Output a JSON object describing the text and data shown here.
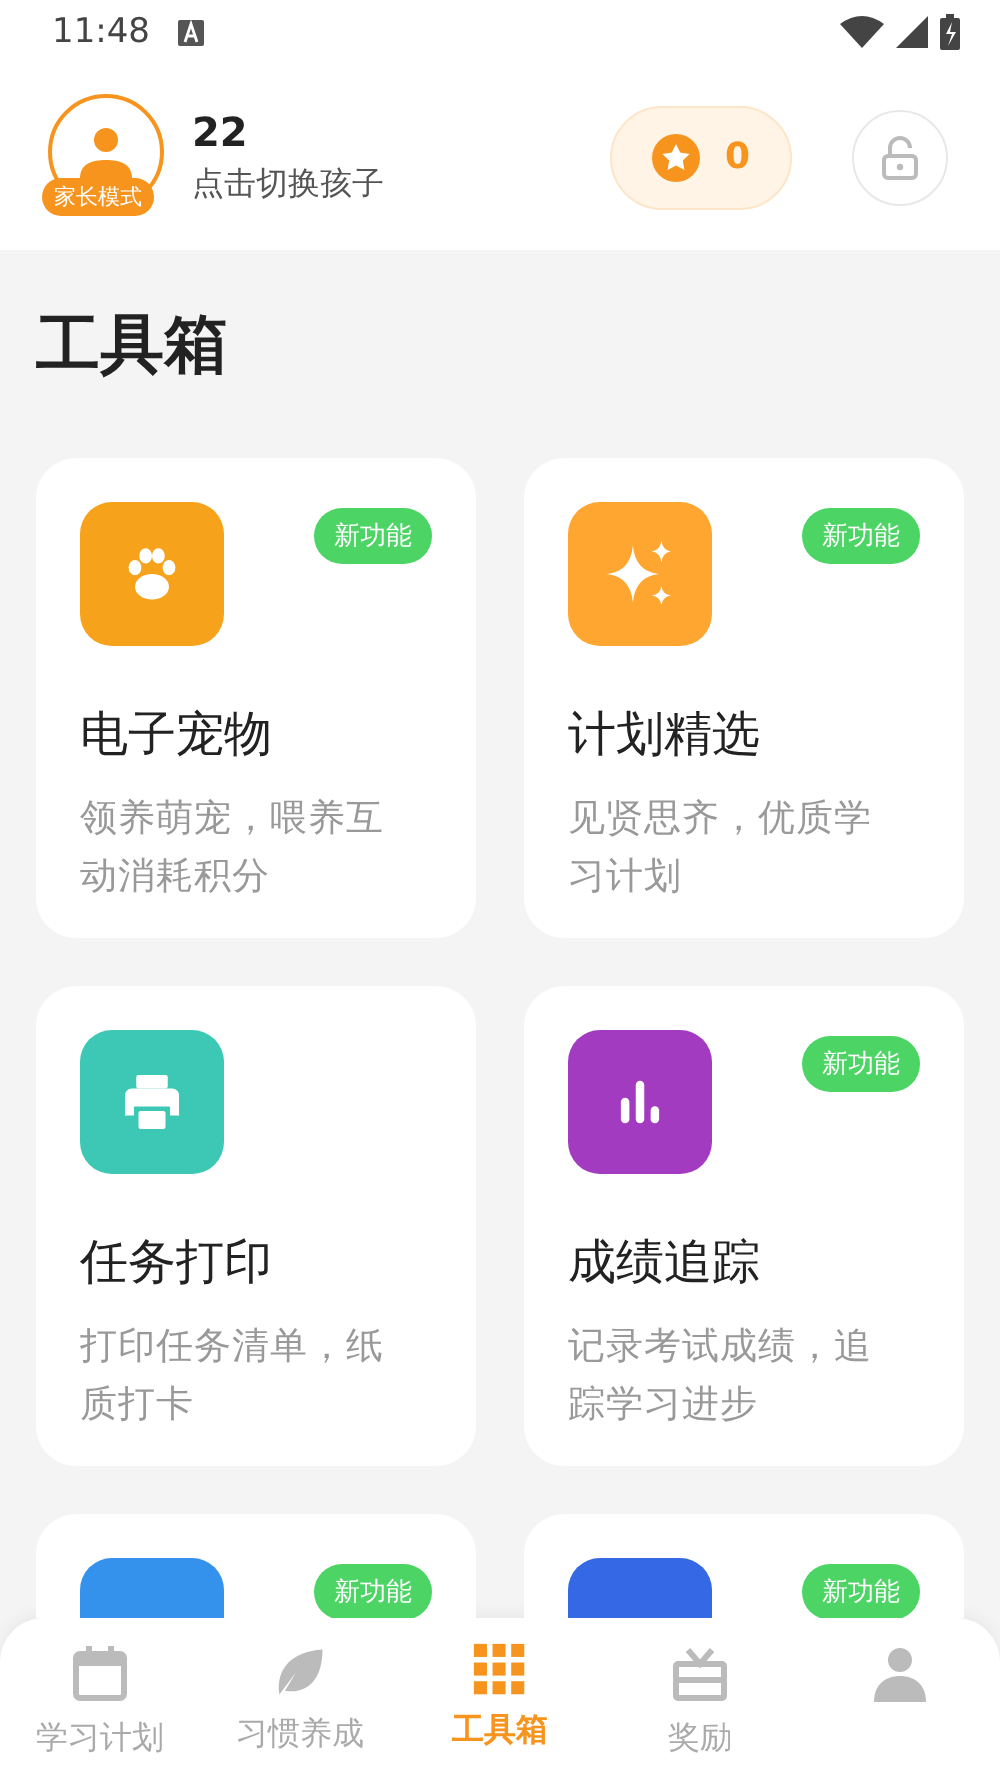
{
  "status_bar": {
    "time": "11:48"
  },
  "header": {
    "mode_badge": "家长模式",
    "name": "22",
    "subtitle": "点击切换孩子",
    "points": "0"
  },
  "title": "工具箱",
  "cards": [
    {
      "kind": "paw",
      "color": "#f7a21b",
      "badge": "新功能",
      "title": "电子宠物",
      "description": "领养萌宠，喂养互动消耗积分"
    },
    {
      "kind": "sparkle",
      "color": "#ffa630",
      "badge": "新功能",
      "title": "计划精选",
      "description": "见贤思齐，优质学习计划"
    },
    {
      "kind": "printer",
      "color": "#3cc8b4",
      "title": "任务打印",
      "description": "打印任务清单，纸质打卡"
    },
    {
      "kind": "chart",
      "color": "#a23bc0",
      "badge": "新功能",
      "title": "成绩追踪",
      "description": "记录考试成绩，追踪学习进步"
    },
    {
      "kind": "partial",
      "color": "#3592ec",
      "badge": "新功能"
    },
    {
      "kind": "partial",
      "color": "#3468e4",
      "badge": "新功能"
    }
  ],
  "tabs": [
    {
      "kind": "calendar",
      "label": "学习计划",
      "selected": false
    },
    {
      "kind": "leaf",
      "label": "习惯养成",
      "selected": false
    },
    {
      "kind": "grid",
      "label": "工具箱",
      "selected": true
    },
    {
      "kind": "gift",
      "label": "奖励",
      "selected": false
    },
    {
      "kind": "person",
      "selected": false
    }
  ]
}
